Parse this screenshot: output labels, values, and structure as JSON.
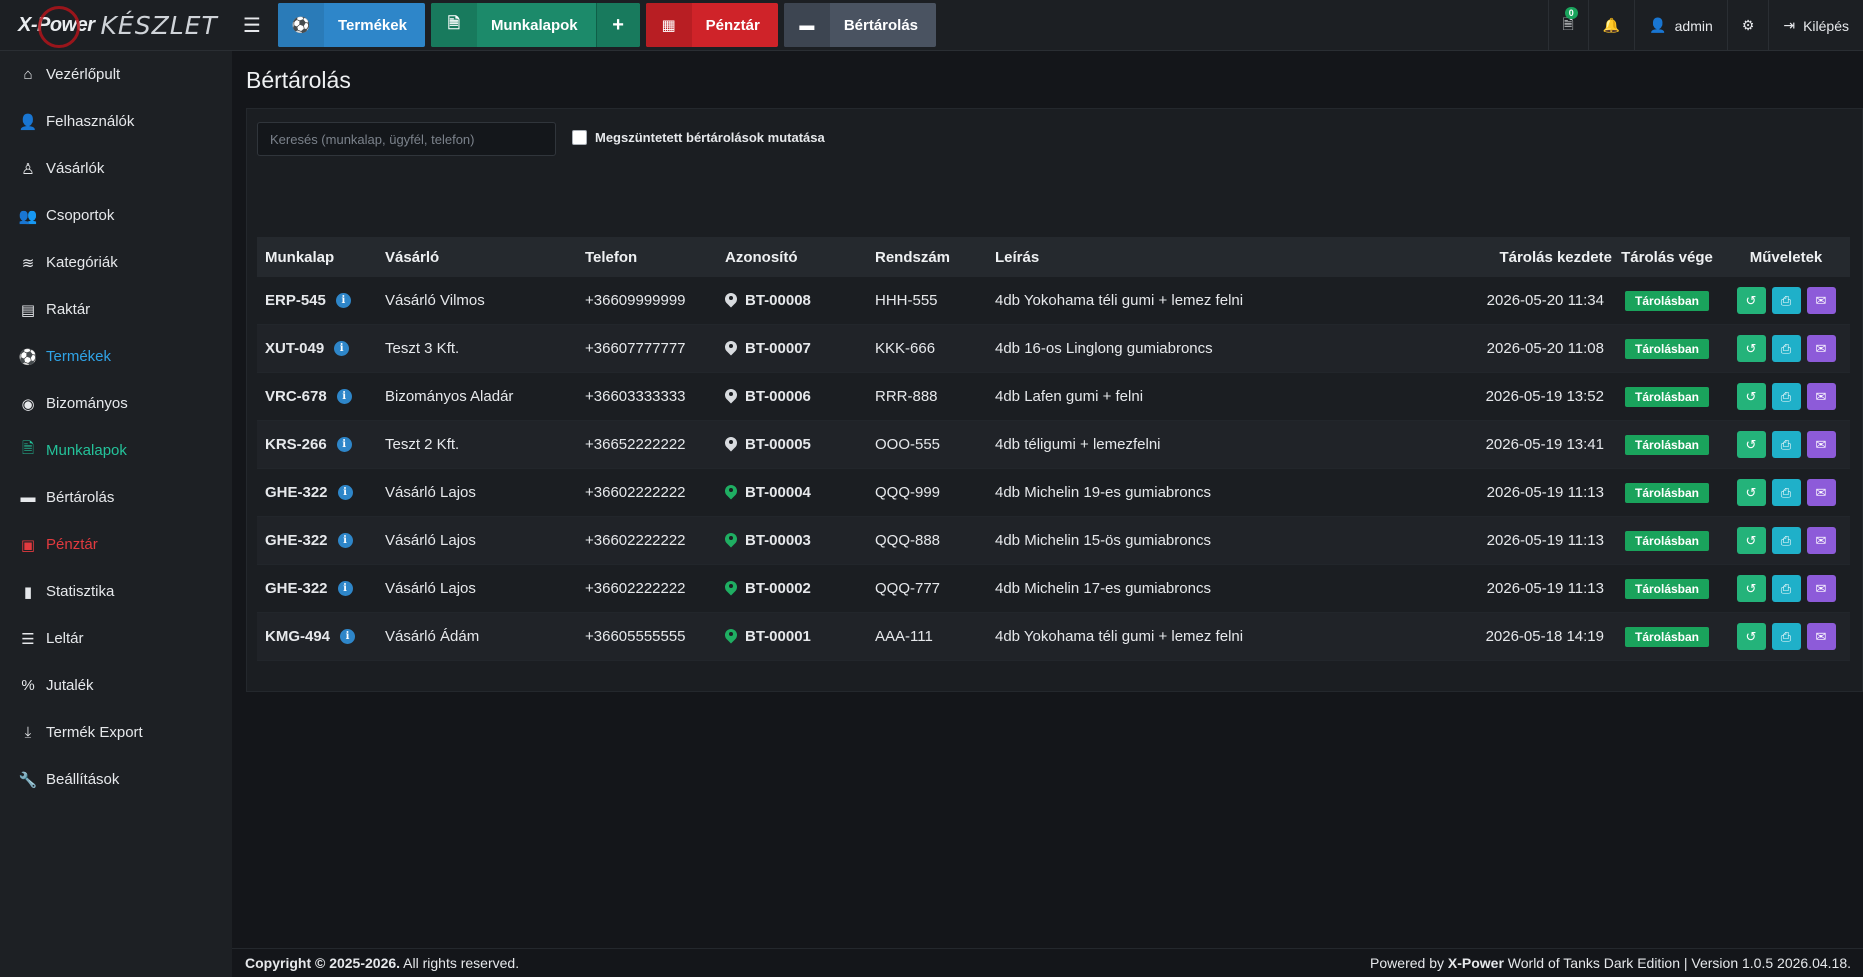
{
  "app": {
    "logo_brand": "X-Power",
    "logo_word": "KÉSZLET"
  },
  "topnav": [
    {
      "label": "Termékek",
      "icon": "soccer-ball-icon",
      "color": "#2e86c9"
    },
    {
      "label": "Munkalapok",
      "icon": "document-icon",
      "plus": "+",
      "color": "#1c8a6a"
    },
    {
      "label": "Pénztár",
      "icon": "calculator-icon",
      "color": "#cf2329"
    },
    {
      "label": "Bértárolás",
      "icon": "archive-icon",
      "color": "#4a5361"
    }
  ],
  "topright": {
    "notification_badge": "0",
    "user": "admin",
    "logout": "Kilépés"
  },
  "sidebar": [
    {
      "label": "Vezérlőpult",
      "icon": "home-icon"
    },
    {
      "label": "Felhasználók",
      "icon": "user-icon"
    },
    {
      "label": "Vásárlók",
      "icon": "user-outline-icon"
    },
    {
      "label": "Csoportok",
      "icon": "users-icon"
    },
    {
      "label": "Kategóriák",
      "icon": "layers-icon"
    },
    {
      "label": "Raktár",
      "icon": "warehouse-icon"
    },
    {
      "label": "Termékek",
      "icon": "soccer-ball-icon",
      "state": "active-blue"
    },
    {
      "label": "Bizományos",
      "icon": "user-circle-icon"
    },
    {
      "label": "Munkalapok",
      "icon": "document-icon",
      "state": "active-teal"
    },
    {
      "label": "Bértárolás",
      "icon": "archive-icon"
    },
    {
      "label": "Pénztár",
      "icon": "money-icon",
      "state": "active-red"
    },
    {
      "label": "Statisztika",
      "icon": "chart-icon"
    },
    {
      "label": "Leltár",
      "icon": "list-icon"
    },
    {
      "label": "Jutalék",
      "icon": "percent-icon"
    },
    {
      "label": "Termék Export",
      "icon": "download-icon"
    },
    {
      "label": "Beállítások",
      "icon": "wrench-icon"
    }
  ],
  "page": {
    "title": "Bértárolás",
    "search_placeholder": "Keresés (munkalap, ügyfél, telefon)",
    "checkbox_label": "Megszüntetett bértárolások mutatása"
  },
  "table": {
    "headers": [
      "Munkalap",
      "Vásárló",
      "Telefon",
      "Azonosító",
      "Rendszám",
      "Leírás",
      "Tárolás kezdete",
      "Tárolás vége",
      "Műveletek"
    ],
    "rows": [
      {
        "munkalap": "ERP-545",
        "vasarlo": "Vásárló Vilmos",
        "telefon": "+36609999999",
        "azonosito": "BT-00008",
        "pin": "grey",
        "rendszam": "HHH-555",
        "leiras": "4db Yokohama téli gumi + lemez felni",
        "kezdete": "2026-05-20 11:34",
        "status": "Tárolásban"
      },
      {
        "munkalap": "XUT-049",
        "vasarlo": "Teszt 3 Kft.",
        "telefon": "+36607777777",
        "azonosito": "BT-00007",
        "pin": "grey",
        "rendszam": "KKK-666",
        "leiras": "4db 16-os Linglong gumiabroncs",
        "kezdete": "2026-05-20 11:08",
        "status": "Tárolásban"
      },
      {
        "munkalap": "VRC-678",
        "vasarlo": "Bizományos Aladár",
        "telefon": "+36603333333",
        "azonosito": "BT-00006",
        "pin": "grey",
        "rendszam": "RRR-888",
        "leiras": "4db Lafen gumi + felni",
        "kezdete": "2026-05-19 13:52",
        "status": "Tárolásban"
      },
      {
        "munkalap": "KRS-266",
        "vasarlo": "Teszt 2 Kft.",
        "telefon": "+36652222222",
        "azonosito": "BT-00005",
        "pin": "grey",
        "rendszam": "OOO-555",
        "leiras": "4db téligumi + lemezfelni",
        "kezdete": "2026-05-19 13:41",
        "status": "Tárolásban"
      },
      {
        "munkalap": "GHE-322",
        "vasarlo": "Vásárló Lajos",
        "telefon": "+36602222222",
        "azonosito": "BT-00004",
        "pin": "green",
        "rendszam": "QQQ-999",
        "leiras": "4db Michelin 19-es gumiabroncs",
        "kezdete": "2026-05-19 11:13",
        "status": "Tárolásban"
      },
      {
        "munkalap": "GHE-322",
        "vasarlo": "Vásárló Lajos",
        "telefon": "+36602222222",
        "azonosito": "BT-00003",
        "pin": "green",
        "rendszam": "QQQ-888",
        "leiras": "4db Michelin 15-ös gumiabroncs",
        "kezdete": "2026-05-19 11:13",
        "status": "Tárolásban"
      },
      {
        "munkalap": "GHE-322",
        "vasarlo": "Vásárló Lajos",
        "telefon": "+36602222222",
        "azonosito": "BT-00002",
        "pin": "green",
        "rendszam": "QQQ-777",
        "leiras": "4db Michelin 17-es gumiabroncs",
        "kezdete": "2026-05-19 11:13",
        "status": "Tárolásban"
      },
      {
        "munkalap": "KMG-494",
        "vasarlo": "Vásárló Ádám",
        "telefon": "+36605555555",
        "azonosito": "BT-00001",
        "pin": "green",
        "rendszam": "AAA-111",
        "leiras": "4db Yokohama téli gumi + lemez felni",
        "kezdete": "2026-05-18 14:19",
        "status": "Tárolásban"
      }
    ]
  },
  "footer": {
    "copyright_bold": "Copyright © 2025-2026.",
    "copyright_rest": " All rights reserved.",
    "powered_prefix": "Powered by ",
    "powered_brand": "X-Power",
    "powered_rest": " World of Tanks Dark Edition | Version 1.0.5 2026.04.18."
  },
  "colors": {
    "status_green": "#1aa35c",
    "restore": "#24b37a",
    "print": "#1fb0c9",
    "mail": "#8d5bd9"
  }
}
